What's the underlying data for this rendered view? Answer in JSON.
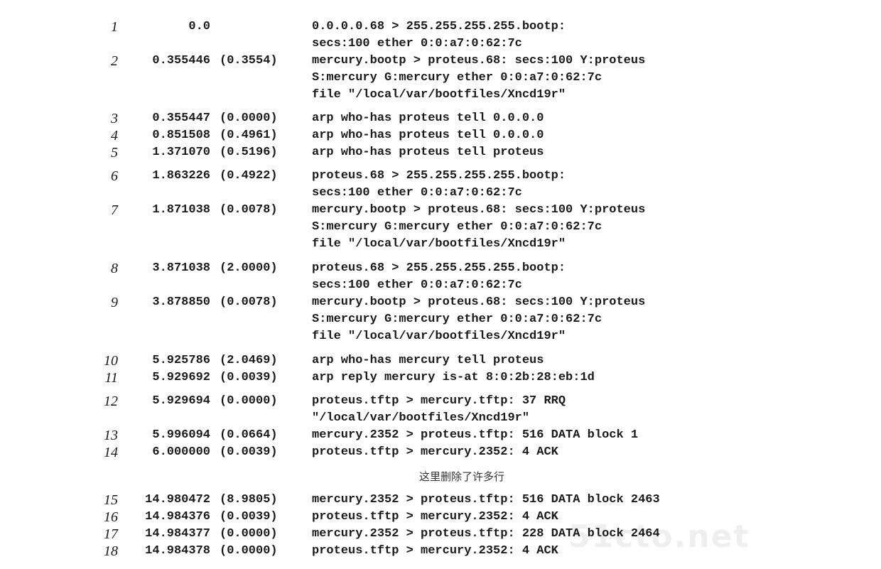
{
  "trace": [
    {
      "num": "1",
      "time": "0.0",
      "delta": "",
      "lines": [
        "0.0.0.0.68 > 255.255.255.255.bootp:",
        "secs:100 ether 0:0:a7:0:62:7c"
      ]
    },
    {
      "num": "2",
      "time": "0.355446",
      "delta": "(0.3554)",
      "lines": [
        "mercury.bootp > proteus.68: secs:100 Y:proteus",
        "S:mercury G:mercury ether 0:0:a7:0:62:7c",
        "file \"/local/var/bootfiles/Xncd19r\""
      ]
    },
    {
      "num": "3",
      "time": "0.355447",
      "delta": "(0.0000)",
      "lines": [
        "arp who-has proteus tell 0.0.0.0"
      ]
    },
    {
      "num": "4",
      "time": "0.851508",
      "delta": "(0.4961)",
      "lines": [
        "arp who-has proteus tell 0.0.0.0"
      ]
    },
    {
      "num": "5",
      "time": "1.371070",
      "delta": "(0.5196)",
      "lines": [
        "arp who-has proteus tell proteus"
      ]
    },
    {
      "num": "6",
      "time": "1.863226",
      "delta": "(0.4922)",
      "lines": [
        "proteus.68 > 255.255.255.255.bootp:",
        "secs:100 ether 0:0:a7:0:62:7c"
      ]
    },
    {
      "num": "7",
      "time": "1.871038",
      "delta": "(0.0078)",
      "lines": [
        "mercury.bootp > proteus.68: secs:100 Y:proteus",
        "S:mercury G:mercury ether 0:0:a7:0:62:7c",
        "file \"/local/var/bootfiles/Xncd19r\""
      ]
    },
    {
      "num": "8",
      "time": "3.871038",
      "delta": "(2.0000)",
      "lines": [
        "proteus.68 > 255.255.255.255.bootp:",
        "secs:100 ether 0:0:a7:0:62:7c"
      ]
    },
    {
      "num": "9",
      "time": "3.878850",
      "delta": "(0.0078)",
      "lines": [
        "mercury.bootp > proteus.68: secs:100 Y:proteus",
        "S:mercury G:mercury ether 0:0:a7:0:62:7c",
        "file \"/local/var/bootfiles/Xncd19r\""
      ]
    },
    {
      "num": "10",
      "time": "5.925786",
      "delta": "(2.0469)",
      "lines": [
        "arp who-has mercury tell proteus"
      ]
    },
    {
      "num": "11",
      "time": "5.929692",
      "delta": "(0.0039)",
      "lines": [
        "arp reply mercury is-at 8:0:2b:28:eb:1d"
      ]
    },
    {
      "num": "12",
      "time": "5.929694",
      "delta": "(0.0000)",
      "lines": [
        "proteus.tftp > mercury.tftp: 37 RRQ",
        "\"/local/var/bootfiles/Xncd19r\""
      ]
    },
    {
      "num": "13",
      "time": "5.996094",
      "delta": "(0.0664)",
      "lines": [
        "mercury.2352 > proteus.tftp: 516 DATA block 1"
      ]
    },
    {
      "num": "14",
      "time": "6.000000",
      "delta": "(0.0039)",
      "lines": [
        "proteus.tftp > mercury.2352: 4 ACK"
      ]
    },
    {
      "num": "15",
      "time": "14.980472",
      "delta": "(8.9805)",
      "lines": [
        "mercury.2352 > proteus.tftp: 516 DATA block 2463"
      ]
    },
    {
      "num": "16",
      "time": "14.984376",
      "delta": "(0.0039)",
      "lines": [
        "proteus.tftp > mercury.2352: 4 ACK"
      ]
    },
    {
      "num": "17",
      "time": "14.984377",
      "delta": "(0.0000)",
      "lines": [
        "mercury.2352 > proteus.tftp: 228 DATA block 2464"
      ]
    },
    {
      "num": "18",
      "time": "14.984378",
      "delta": "(0.0000)",
      "lines": [
        "proteus.tftp > mercury.2352: 4 ACK"
      ]
    }
  ],
  "omitted_note": "这里删除了许多行",
  "watermark": "51cto.net"
}
